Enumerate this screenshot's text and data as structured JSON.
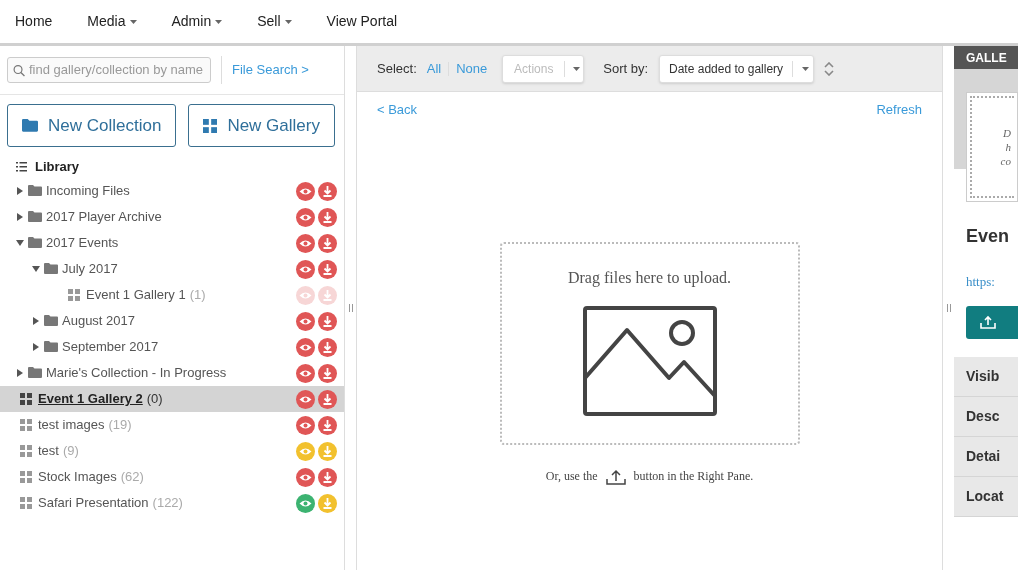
{
  "nav": [
    {
      "label": "Home",
      "dropdown": false
    },
    {
      "label": "Media",
      "dropdown": true
    },
    {
      "label": "Admin",
      "dropdown": true
    },
    {
      "label": "Sell",
      "dropdown": true
    },
    {
      "label": "View Portal",
      "dropdown": false
    }
  ],
  "sidebar": {
    "search": {
      "placeholder": "find gallery/collection by name"
    },
    "file_search": "File Search >",
    "buttons": [
      {
        "label": "New Collection",
        "kind": "folder"
      },
      {
        "label": "New Gallery",
        "kind": "gallery"
      }
    ],
    "library": "Library",
    "tree": [
      {
        "kind": "folder",
        "name": "Incoming Files",
        "expanded": false,
        "selected": false,
        "dimmed": false,
        "eye": {
          "color": "#e05656"
        },
        "download": {
          "color": "#e05656"
        }
      },
      {
        "kind": "folder",
        "name": "2017 Player Archive",
        "expanded": false,
        "selected": false,
        "dimmed": false,
        "eye": {
          "color": "#e05656"
        },
        "download": {
          "color": "#e05656"
        }
      },
      {
        "kind": "folder",
        "name": "2017 Events",
        "expanded": true,
        "selected": false,
        "dimmed": false,
        "eye": {
          "color": "#e05656"
        },
        "download": {
          "color": "#e05656"
        },
        "children": [
          {
            "kind": "folder",
            "name": "July 2017",
            "expanded": true,
            "selected": false,
            "dimmed": false,
            "eye": {
              "color": "#e05656"
            },
            "download": {
              "color": "#e05656"
            },
            "children": [
              {
                "kind": "gallery",
                "name": "Event 1 Gallery 1",
                "count": "(1)",
                "selected": false,
                "dimmed": false,
                "eye": {
                  "color": "#f7d6d6"
                },
                "download": {
                  "color": "#f7d6d6"
                }
              }
            ]
          },
          {
            "kind": "folder",
            "name": "August 2017",
            "expanded": false,
            "selected": false,
            "dimmed": false,
            "eye": {
              "color": "#e05656"
            },
            "download": {
              "color": "#e05656"
            }
          },
          {
            "kind": "folder",
            "name": "September 2017",
            "expanded": false,
            "selected": false,
            "dimmed": false,
            "eye": {
              "color": "#e05656"
            },
            "download": {
              "color": "#e05656"
            }
          }
        ]
      },
      {
        "kind": "folder",
        "name": "Marie's Collection - In Progress",
        "expanded": false,
        "selected": false,
        "dimmed": false,
        "eye": {
          "color": "#e05656"
        },
        "download": {
          "color": "#e05656"
        }
      },
      {
        "kind": "gallery",
        "name": "Event 1 Gallery 2",
        "count": "(0)",
        "selected": true,
        "dimmed": false,
        "eye": {
          "color": "#e05656"
        },
        "download": {
          "color": "#e05656"
        }
      },
      {
        "kind": "gallery",
        "name": "test images",
        "count": "(19)",
        "selected": false,
        "dimmed": false,
        "eye": {
          "color": "#e05656"
        },
        "download": {
          "color": "#e05656"
        }
      },
      {
        "kind": "gallery",
        "name": "test",
        "count": "(9)",
        "selected": false,
        "dimmed": false,
        "eye": {
          "color": "#f2c12e"
        },
        "download": {
          "color": "#f2c12e"
        }
      },
      {
        "kind": "gallery",
        "name": "Stock Images",
        "count": "(62)",
        "selected": false,
        "dimmed": false,
        "eye": {
          "color": "#e05656"
        },
        "download": {
          "color": "#e05656"
        }
      },
      {
        "kind": "gallery",
        "name": "Safari Presentation",
        "count": "(122)",
        "selected": false,
        "dimmed": false,
        "eye": {
          "color": "#3cb371"
        },
        "download": {
          "color": "#f2c12e"
        }
      }
    ]
  },
  "toolbar": {
    "select_label": "Select:",
    "select_all": "All",
    "select_none": "None",
    "actions": "Actions",
    "sort_label": "Sort by:",
    "sort_value": "Date added to gallery"
  },
  "content": {
    "back": "< Back",
    "refresh": "Refresh",
    "drop_text": "Drag files here to upload.",
    "hint_before": "Or, use the",
    "hint_after": "button in the Right Pane."
  },
  "right_pane": {
    "header": "GALLE",
    "cover_lines": [
      "D",
      "h",
      "co"
    ],
    "title": "Even",
    "link": "https:",
    "sections": [
      "Visib",
      "Desc",
      "Detai",
      "Locat"
    ]
  }
}
